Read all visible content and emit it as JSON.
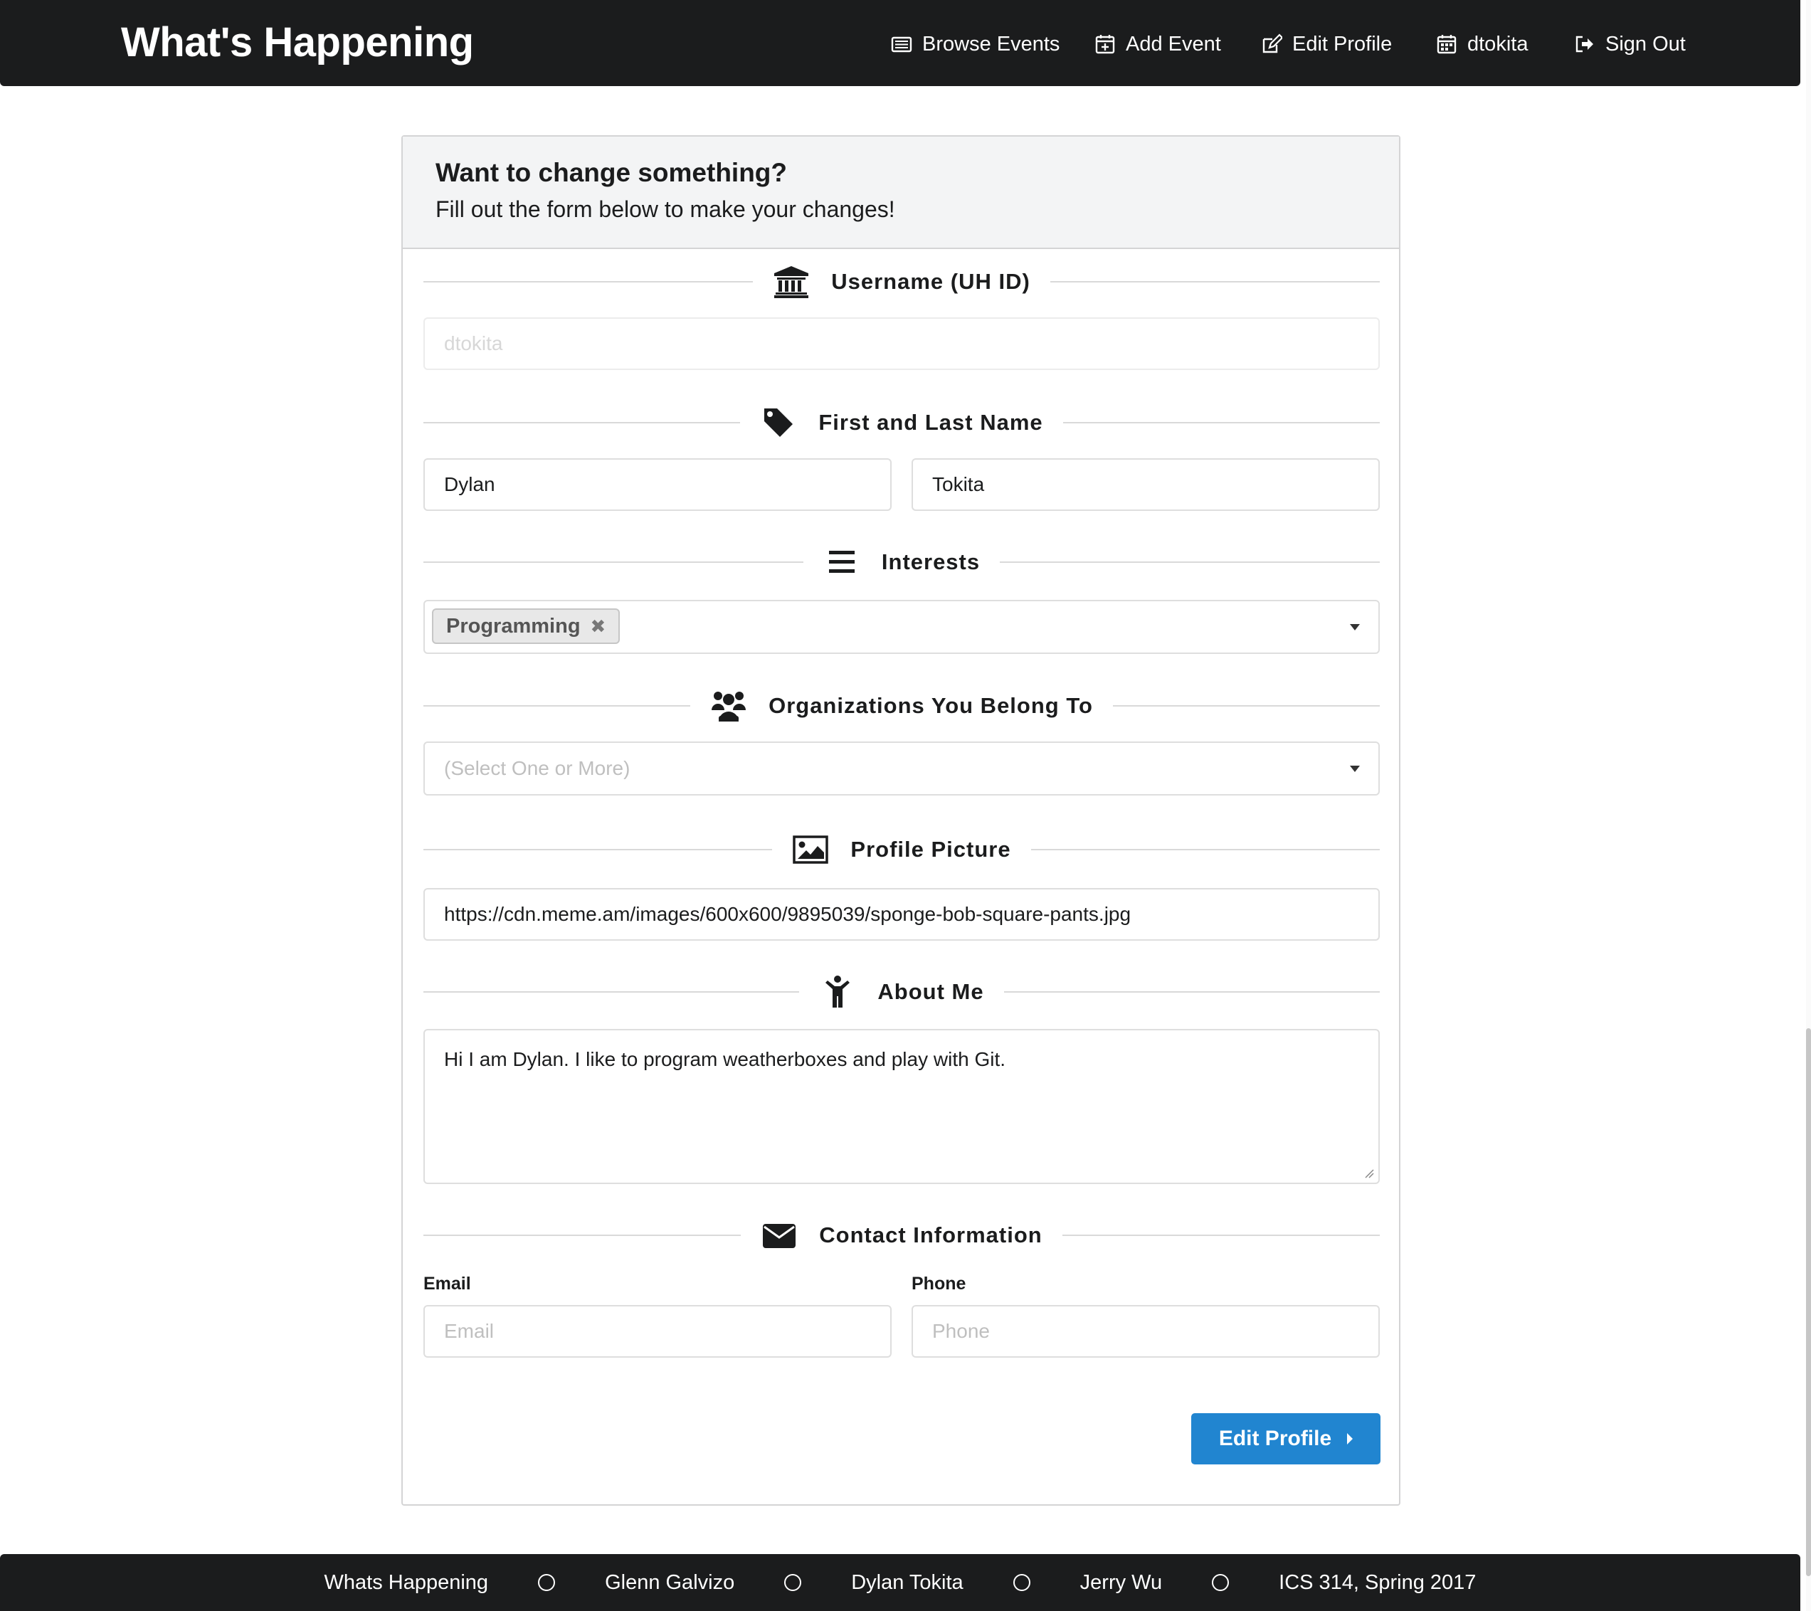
{
  "nav": {
    "brand": "What's Happening",
    "items": [
      {
        "label": "Browse Events",
        "icon": "newspaper-icon"
      },
      {
        "label": "Add Event",
        "icon": "calendar-plus-icon"
      },
      {
        "label": "Edit Profile",
        "icon": "edit-icon"
      },
      {
        "label": "dtokita",
        "icon": "calendar-icon"
      },
      {
        "label": "Sign Out",
        "icon": "sign-out-icon"
      }
    ]
  },
  "form": {
    "title": "Want to change something?",
    "subtitle": "Fill out the form below to make your changes!",
    "sections": {
      "username": {
        "label": "Username (UH ID)",
        "icon": "university-icon",
        "value": "dtokita"
      },
      "name": {
        "label": "First and Last Name",
        "icon": "tag-icon",
        "first": "Dylan",
        "last": "Tokita"
      },
      "interests": {
        "label": "Interests",
        "icon": "list-icon",
        "selected": [
          "Programming"
        ]
      },
      "organizations": {
        "label": "Organizations You Belong To",
        "icon": "users-icon",
        "placeholder": "(Select One or More)"
      },
      "picture": {
        "label": "Profile Picture",
        "icon": "image-icon",
        "value": "https://cdn.meme.am/images/600x600/9895039/sponge-bob-square-pants.jpg"
      },
      "about": {
        "label": "About Me",
        "icon": "child-icon",
        "value": "Hi I am Dylan. I like to program weatherboxes and play with Git."
      },
      "contact": {
        "label": "Contact Information",
        "icon": "envelope-icon",
        "email_label": "Email",
        "email_placeholder": "Email",
        "phone_label": "Phone",
        "phone_placeholder": "Phone"
      }
    },
    "submit_label": "Edit Profile",
    "accent": "#2185d0"
  },
  "footer": {
    "items": [
      "Whats Happening",
      "Glenn Galvizo",
      "Dylan Tokita",
      "Jerry Wu",
      "ICS 314, Spring 2017"
    ]
  }
}
